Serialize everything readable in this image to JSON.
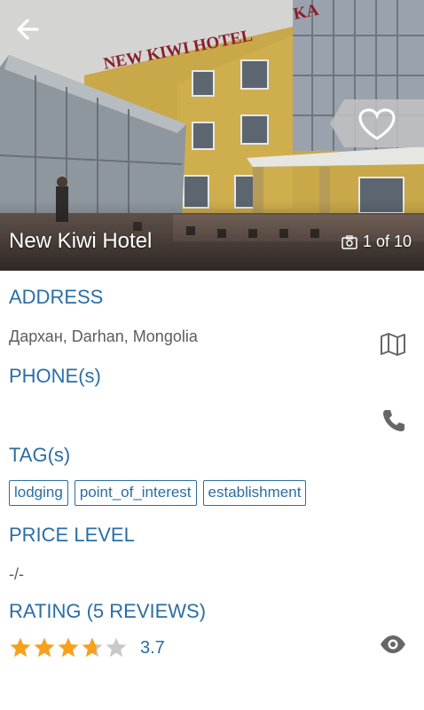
{
  "hero": {
    "hotel_name": "New Kiwi Hotel",
    "photo_counter": "1 of 10",
    "sign_text": "NEW KIWI HOTEL",
    "sign_text_right": "KA"
  },
  "address": {
    "title": "ADDRESS",
    "value": "Дархан, Darhan, Mongolia",
    "icon": "map-icon"
  },
  "phone": {
    "title": "PHONE(s)",
    "value": "",
    "icon": "phone-icon"
  },
  "tags": {
    "title": "TAG(s)",
    "items": [
      "lodging",
      "point_of_interest",
      "establishment"
    ]
  },
  "price": {
    "title": "PRICE LEVEL",
    "value": "-/-"
  },
  "rating": {
    "title": "RATING (5 REVIEWS)",
    "value": "3.7",
    "stars_filled": 3.7,
    "stars_total": 5,
    "icon": "eye-icon"
  },
  "colors": {
    "accent": "#2a6ea6",
    "star_filled": "#f7a01d",
    "star_empty": "#c9c9c9",
    "icon_gray": "#666666"
  }
}
